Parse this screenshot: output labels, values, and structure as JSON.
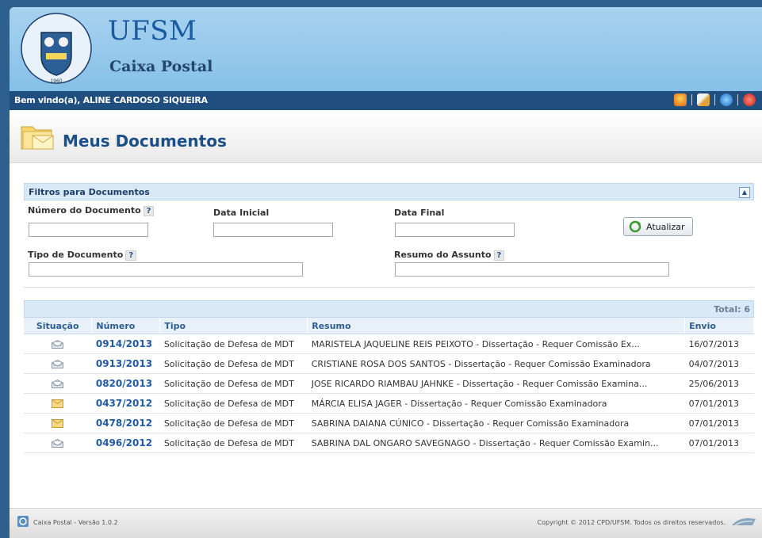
{
  "header": {
    "seal_text": "Universidade Federal de Santa Maria",
    "seal_year": "1960",
    "title": "UFSM",
    "subtitle": "Caixa Postal"
  },
  "userbar": {
    "welcome": "Bem vindo(a), ALINE CARDOSO SIQUEIRA",
    "icons": [
      "home-icon",
      "tools-icon",
      "help-icon",
      "power-icon"
    ]
  },
  "page": {
    "title": "Meus Documentos"
  },
  "filters": {
    "title": "Filtros para Documentos",
    "numero_label": "Número do Documento",
    "data_inicial_label": "Data Inicial",
    "data_final_label": "Data Final",
    "tipo_label": "Tipo de Documento",
    "resumo_label": "Resumo do Assunto",
    "help": "?",
    "refresh_label": "Atualizar",
    "collapse": "▲"
  },
  "grid": {
    "total": "Total: 6",
    "columns": [
      "Situação",
      "Número",
      "Tipo",
      "Resumo",
      "Envio"
    ],
    "rows": [
      {
        "status": "read",
        "numero": "0914/2013",
        "tipo": "Solicitação de Defesa de MDT",
        "resumo": "MARISTELA JAQUELINE REIS PEIXOTO - Dissertação - Requer Comissão Ex...",
        "envio": "16/07/2013"
      },
      {
        "status": "read",
        "numero": "0913/2013",
        "tipo": "Solicitação de Defesa de MDT",
        "resumo": "CRISTIANE ROSA DOS SANTOS - Dissertação - Requer Comissão Examinadora",
        "envio": "04/07/2013"
      },
      {
        "status": "read",
        "numero": "0820/2013",
        "tipo": "Solicitação de Defesa de MDT",
        "resumo": "JOSE RICARDO RIAMBAU JAHNKE - Dissertação - Requer Comissão Examina...",
        "envio": "25/06/2013"
      },
      {
        "status": "unread",
        "numero": "0437/2012",
        "tipo": "Solicitação de Defesa de MDT",
        "resumo": "MÁRCIA ELISA JAGER - Dissertação - Requer Comissão Examinadora",
        "envio": "07/01/2013"
      },
      {
        "status": "unread",
        "numero": "0478/2012",
        "tipo": "Solicitação de Defesa de MDT",
        "resumo": "SABRINA DAIANA CÚNICO - Dissertação - Requer Comissão Examinadora",
        "envio": "07/01/2013"
      },
      {
        "status": "read",
        "numero": "0496/2012",
        "tipo": "Solicitação de Defesa de MDT",
        "resumo": "SABRINA DAL ONGARO SAVEGNAGO - Dissertação - Requer Comissão Examin...",
        "envio": "07/01/2013"
      }
    ]
  },
  "footer": {
    "version": "Caixa Postal - Versão 1.0.2",
    "copyright": "Copyright © 2012 CPD/UFSM. Todos os direitos reservados."
  },
  "colors": {
    "header_bg": "#9ccbec",
    "userbar_bg": "#1f4e7f",
    "link_blue": "#2059a5",
    "title_blue": "#1b4f86"
  }
}
